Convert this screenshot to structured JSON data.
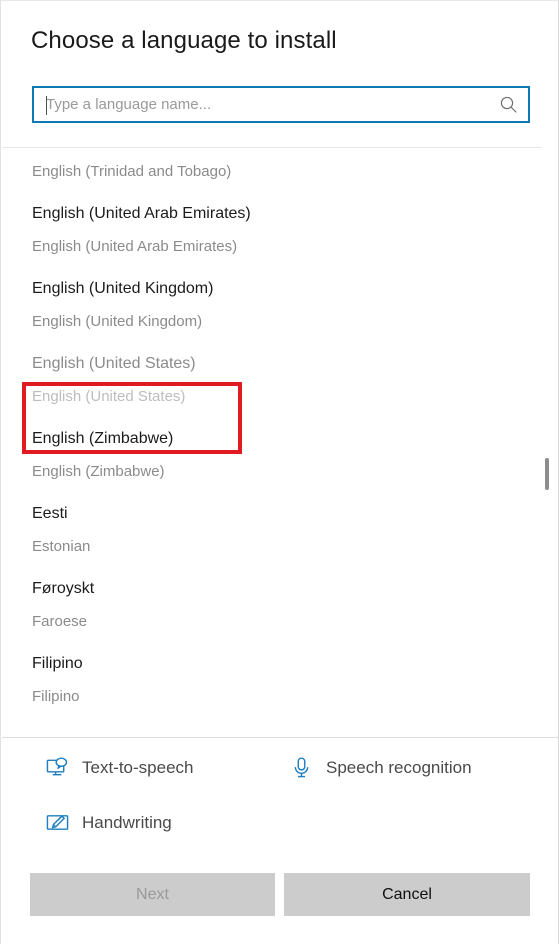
{
  "dialog": {
    "title": "Choose a language to install"
  },
  "search": {
    "placeholder": "Type a language name...",
    "value": "",
    "icon": "search-icon",
    "focus_border_color": "#0d7ab5"
  },
  "list": {
    "items": [
      {
        "native": "English (Trinidad and Tobago)",
        "english": "English (Trinidad and Tobago)",
        "disabled": false,
        "clipped_top": true
      },
      {
        "native": "English (United Arab Emirates)",
        "english": "English (United Arab Emirates)",
        "disabled": false
      },
      {
        "native": "English (United Kingdom)",
        "english": "English (United Kingdom)",
        "disabled": false
      },
      {
        "native": "English (United States)",
        "english": "English (United States)",
        "disabled": true,
        "annotated": true
      },
      {
        "native": "English (Zimbabwe)",
        "english": "English (Zimbabwe)",
        "disabled": false
      },
      {
        "native": "Eesti",
        "english": "Estonian",
        "disabled": false
      },
      {
        "native": "Føroyskt",
        "english": "Faroese",
        "disabled": false
      },
      {
        "native": "Filipino",
        "english": "Filipino",
        "disabled": false,
        "clipped_bottom": true
      }
    ],
    "scrollbar": {
      "visible": true
    }
  },
  "annotation": {
    "color": "#e01b22",
    "target": "English (United States)"
  },
  "features": [
    {
      "label": "Text-to-speech",
      "icon": "text-to-speech-icon",
      "color": "#1f7fc0"
    },
    {
      "label": "Speech recognition",
      "icon": "microphone-icon",
      "color": "#1f7fc0"
    },
    {
      "label": "Handwriting",
      "icon": "handwriting-pen-icon",
      "color": "#1f7fc0"
    }
  ],
  "buttons": {
    "next_label": "Next",
    "cancel_label": "Cancel",
    "next_enabled": false,
    "cancel_enabled": true,
    "background": "#cccccc"
  }
}
